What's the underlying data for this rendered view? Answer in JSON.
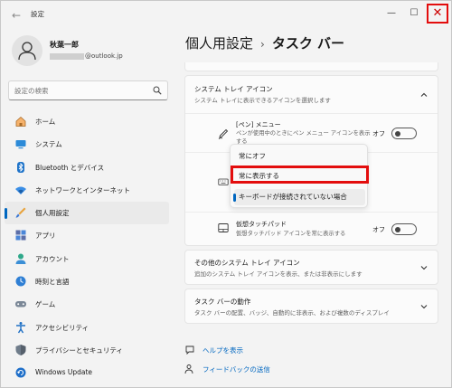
{
  "window": {
    "title": "設定",
    "back_icon": "back-arrow-icon"
  },
  "controls": {
    "minimize": "—",
    "maximize": "☐",
    "close": "✕"
  },
  "profile": {
    "name": "秋葉一郎",
    "email_visible": "@outlook.jp"
  },
  "search": {
    "placeholder": "設定の検索"
  },
  "nav": {
    "items": [
      {
        "label": "ホーム",
        "icon": "home-icon"
      },
      {
        "label": "システム",
        "icon": "system-icon"
      },
      {
        "label": "Bluetooth とデバイス",
        "icon": "bluetooth-icon"
      },
      {
        "label": "ネットワークとインターネット",
        "icon": "network-icon"
      },
      {
        "label": "個人用設定",
        "icon": "personalization-icon",
        "active": true
      },
      {
        "label": "アプリ",
        "icon": "apps-icon"
      },
      {
        "label": "アカウント",
        "icon": "account-icon"
      },
      {
        "label": "時刻と言語",
        "icon": "time-language-icon"
      },
      {
        "label": "ゲーム",
        "icon": "gaming-icon"
      },
      {
        "label": "アクセシビリティ",
        "icon": "accessibility-icon"
      },
      {
        "label": "プライバシーとセキュリティ",
        "icon": "privacy-icon"
      },
      {
        "label": "Windows Update",
        "icon": "windows-update-icon"
      }
    ]
  },
  "breadcrumb": {
    "parent": "個人用設定",
    "separator": "›",
    "current": "タスク バー"
  },
  "tray": {
    "title": "システム トレイ アイコン",
    "subtitle": "システム トレイに表示できるアイコンを選択します",
    "rows": {
      "pen": {
        "title": "[ペン] メニュー",
        "subtitle": "ペンが使用中のときにペン メニュー アイコンを表示する",
        "state": "オフ"
      },
      "touchpad": {
        "title": "仮想タッチパッド",
        "subtitle": "仮想タッチパッド アイコンを常に表示する",
        "state": "オフ"
      }
    }
  },
  "dropdown": {
    "options": [
      "常にオフ",
      "常に表示する",
      "キーボードが接続されていない場合"
    ],
    "selected": "キーボードが接続されていない場合",
    "highlighted": "常に表示する"
  },
  "other_tray": {
    "title": "その他のシステム トレイ アイコン",
    "subtitle": "追加のシステム トレイ アイコンを表示、または非表示にします"
  },
  "taskbar_behavior": {
    "title": "タスク バーの動作",
    "subtitle": "タスク バーの配置、バッジ、自動的に非表示、および複数のディスプレイ"
  },
  "links": {
    "help": "ヘルプを表示",
    "feedback": "フィードバックの送信"
  },
  "colors": {
    "accent": "#0067c0",
    "highlight": "#e30d0d"
  }
}
